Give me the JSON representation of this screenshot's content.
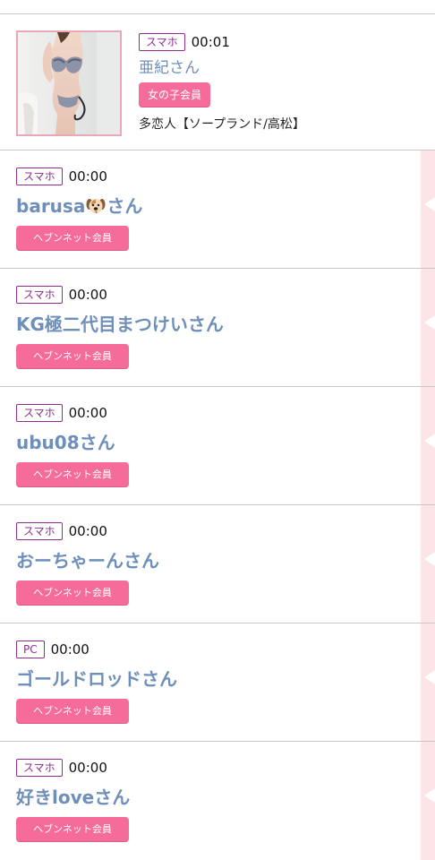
{
  "girl": {
    "device": "スマホ",
    "time": "00:01",
    "name": "亜紀さん",
    "member_type": "女の子会員",
    "shop": "多恋人【ソープランド/高松】"
  },
  "users": [
    {
      "device": "スマホ",
      "time": "00:00",
      "name_prefix": "barusa",
      "name_suffix": "さん",
      "member_type": "ヘブンネット会員"
    },
    {
      "device": "スマホ",
      "time": "00:00",
      "name": "KG極二代目まつけいさん",
      "member_type": "ヘブンネット会員"
    },
    {
      "device": "スマホ",
      "time": "00:00",
      "name": "ubu08さん",
      "member_type": "ヘブンネット会員"
    },
    {
      "device": "スマホ",
      "time": "00:00",
      "name": "おーちゃーんさん",
      "member_type": "ヘブンネット会員"
    },
    {
      "device": "PC",
      "time": "00:00",
      "name": "ゴールドロッドさん",
      "member_type": "ヘブンネット会員"
    },
    {
      "device": "スマホ",
      "time": "00:00",
      "name": "好きloveさん",
      "member_type": "ヘブンネット会員"
    }
  ],
  "colors": {
    "accent_pink": "#f56b9a",
    "device_purple": "#8e2e8e",
    "name_blue": "#6e8fba",
    "strip_pink": "#fde4e7"
  },
  "icons": {
    "dog": "dog-face-emoji"
  }
}
